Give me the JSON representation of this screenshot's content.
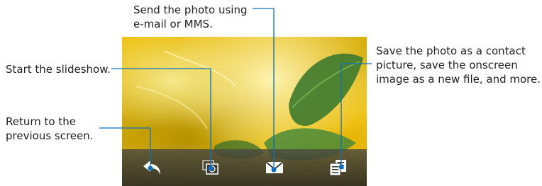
{
  "callouts": {
    "send": "Send the photo using\ne-mail or MMS.",
    "slideshow": "Start the slideshow.",
    "save": "Save the photo as a contact\npicture, save the onscreen\nimage as a new file, and more.",
    "back": "Return to the\nprevious screen."
  },
  "toolbar": {
    "buttons": [
      {
        "icon": "back-arrow-icon"
      },
      {
        "icon": "slideshow-icon"
      },
      {
        "icon": "envelope-icon"
      },
      {
        "icon": "menu-icon"
      }
    ]
  },
  "colors": {
    "callout_line": "#0d6fbf",
    "toolbar_bg": "#3a3a32",
    "icon": "#ffffff"
  }
}
